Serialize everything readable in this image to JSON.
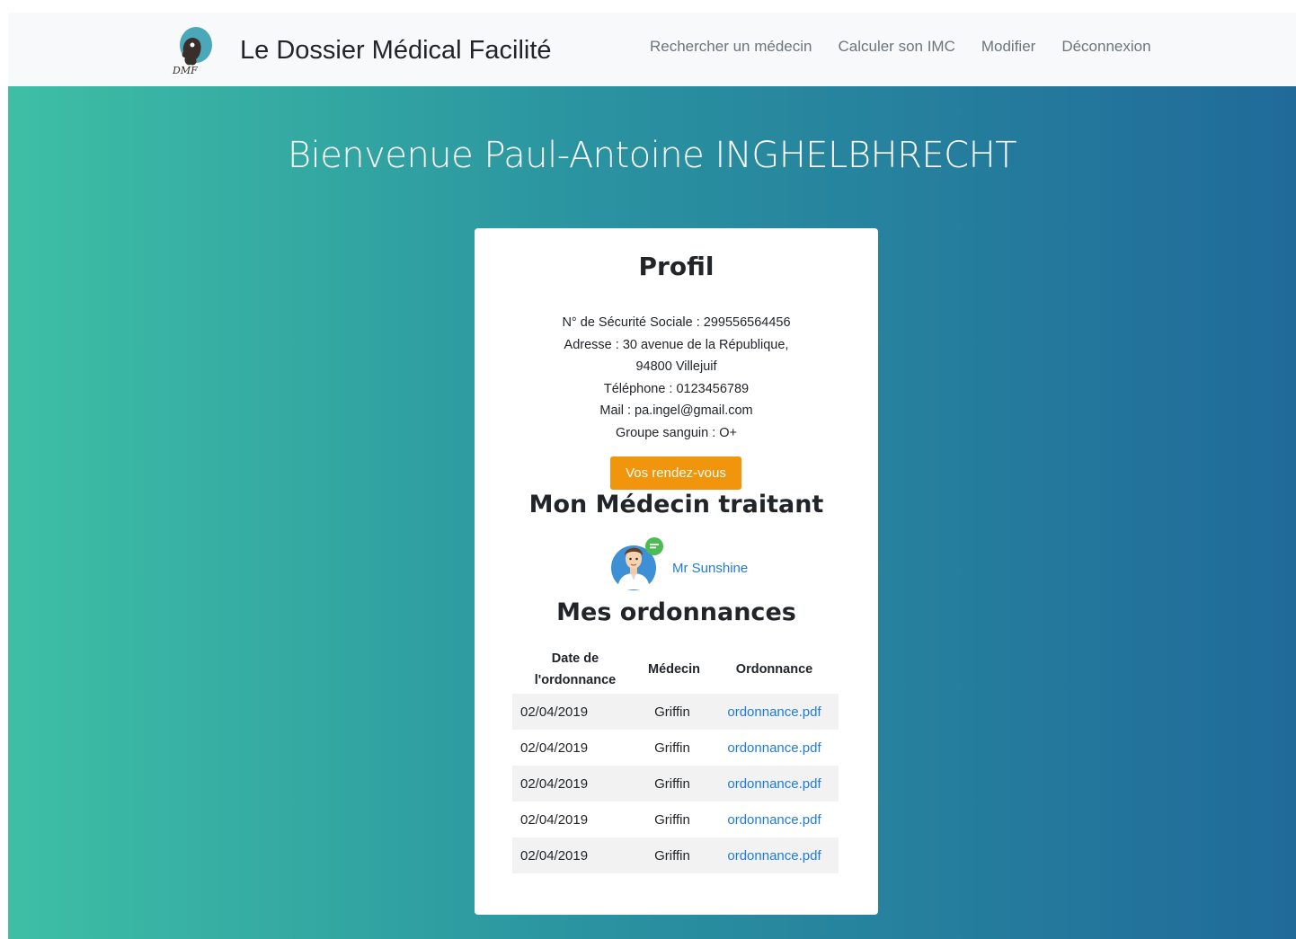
{
  "header": {
    "logo_text": "DMF",
    "brand": "Le Dossier Médical Facilité",
    "nav": [
      {
        "label": "Rechercher un médecin"
      },
      {
        "label": "Calculer son IMC"
      },
      {
        "label": "Modifier"
      },
      {
        "label": "Déconnexion"
      }
    ]
  },
  "colors": {
    "gradient_start": "#3ebfa5",
    "gradient_end": "#206a9a",
    "button": "#f0950c",
    "link": "#1e7bdc"
  },
  "welcome": "Bienvenue Paul-Antoine INGHELBHRECHT",
  "profile": {
    "title": "Profil",
    "lines": [
      "N° de Sécurité Sociale : 299556564456",
      "Adresse : 30 avenue de la République,",
      "94800 Villejuif",
      "Téléphone : 0123456789",
      "Mail : pa.ingel@gmail.com",
      "Groupe sanguin : O+"
    ],
    "appointments_button": "Vos rendez-vous"
  },
  "doctor": {
    "title": "Mon Médecin traitant",
    "name": "Mr Sunshine",
    "avatar_icon": "doctor-avatar-icon"
  },
  "prescriptions": {
    "title": "Mes ordonnances",
    "columns": [
      "Date de l'ordonnance",
      "Médecin",
      "Ordonnance"
    ],
    "rows": [
      {
        "date": "02/04/2019",
        "doctor": "Griffin",
        "file": "ordonnance.pdf"
      },
      {
        "date": "02/04/2019",
        "doctor": "Griffin",
        "file": "ordonnance.pdf"
      },
      {
        "date": "02/04/2019",
        "doctor": "Griffin",
        "file": "ordonnance.pdf"
      },
      {
        "date": "02/04/2019",
        "doctor": "Griffin",
        "file": "ordonnance.pdf"
      },
      {
        "date": "02/04/2019",
        "doctor": "Griffin",
        "file": "ordonnance.pdf"
      }
    ]
  }
}
